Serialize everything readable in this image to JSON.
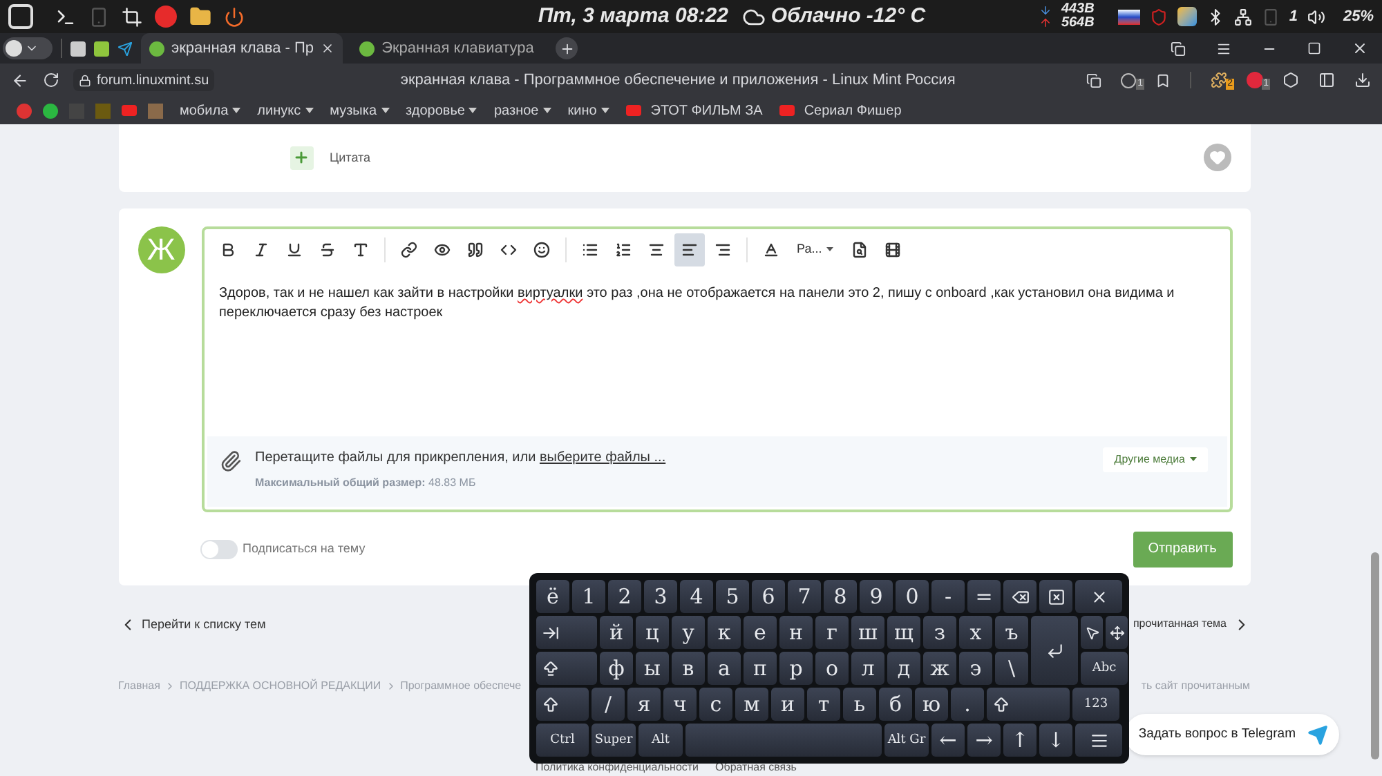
{
  "system_panel": {
    "clock": "Пт, 3 марта 08:22",
    "weather": "Облачно -12° C",
    "net_down": "443B",
    "net_up": "564B",
    "workspace": "1",
    "battery": "25%"
  },
  "browser": {
    "tabs": [
      {
        "title": "экранная клава - Пр",
        "selected": true
      },
      {
        "title": "Экранная клавиатура",
        "selected": false
      }
    ],
    "url": "forum.linuxmint.su",
    "page_title": "экранная клава - Программное обеспечение и приложения - Linux Mint Россия",
    "extension_badges": [
      "1",
      "2",
      "1"
    ],
    "bookmarks": [
      {
        "label": "мобила",
        "kind": "folder"
      },
      {
        "label": "линукс",
        "kind": "folder"
      },
      {
        "label": "музыка",
        "kind": "folder"
      },
      {
        "label": "здоровье",
        "kind": "folder"
      },
      {
        "label": "разное",
        "kind": "folder"
      },
      {
        "label": "кино",
        "kind": "folder"
      },
      {
        "label": "ЭТОТ ФИЛЬМ ЗА",
        "kind": "video"
      },
      {
        "label": "Сериал Фишер",
        "kind": "video"
      }
    ]
  },
  "post_actions": {
    "quote": "Цитата",
    "liked": false
  },
  "editor": {
    "avatar_letter": "Ж",
    "toolbar": [
      {
        "kind": "bold",
        "selected": false
      },
      {
        "kind": "italic",
        "selected": false
      },
      {
        "kind": "underline",
        "selected": false
      },
      {
        "kind": "strike",
        "selected": false
      },
      {
        "kind": "style",
        "selected": false
      },
      {
        "kind": "divider"
      },
      {
        "kind": "link",
        "selected": false
      },
      {
        "kind": "preview",
        "selected": false
      },
      {
        "kind": "quote",
        "selected": false
      },
      {
        "kind": "code",
        "selected": false
      },
      {
        "kind": "emoji",
        "selected": false
      },
      {
        "kind": "divider"
      },
      {
        "kind": "bullets",
        "selected": false
      },
      {
        "kind": "numbers",
        "selected": false
      },
      {
        "kind": "center",
        "selected": false
      },
      {
        "kind": "align_left",
        "selected": true
      },
      {
        "kind": "align_right",
        "selected": false
      },
      {
        "kind": "divider"
      },
      {
        "kind": "color",
        "selected": false
      },
      {
        "kind": "size",
        "label": "Ра...",
        "selected": false
      },
      {
        "kind": "find",
        "selected": false
      },
      {
        "kind": "gif",
        "selected": false
      }
    ],
    "text": [
      {
        "text": "Здоров, так и не нашел как зайти в настройки ",
        "misspelled": false
      },
      {
        "text": "виртуалки",
        "misspelled": true
      },
      {
        "text": " это раз ,она не отображается на панели это 2, пишу с onboard ,как установил она видима и переключается сразу без настроек",
        "misspelled": false
      }
    ],
    "attach_prompt": "Перетащите файлы для прикрепления, или ",
    "attach_link": "выберите файлы ...",
    "limit_label": "Максимальный общий размер:",
    "limit_value": "48.83 МБ",
    "media_button": "Другие медиа"
  },
  "subscribe": {
    "label": "Подписаться на тему",
    "on": false
  },
  "submit": "Отправить",
  "nav": {
    "back": "Перейти к списку тем",
    "next": "прочитанная тема"
  },
  "breadcrumb": [
    "Главная",
    "ПОДДЕРЖКА ОСНОВНОЙ РЕДАКЦИИ",
    "Программное обеспече"
  ],
  "breadcrumb_right": "ть сайт прочитанным",
  "footer_links": [
    "Политика конфиденциальности",
    "Обратная связь"
  ],
  "telegram_button": "Задать вопрос в Telegram",
  "keyboard": {
    "rows": [
      {
        "keys": [
          {
            "kind": "char",
            "label": "ё"
          },
          {
            "kind": "char",
            "label": "1"
          },
          {
            "kind": "char",
            "label": "2"
          },
          {
            "kind": "char",
            "label": "3"
          },
          {
            "kind": "char",
            "label": "4"
          },
          {
            "kind": "char",
            "label": "5"
          },
          {
            "kind": "char",
            "label": "6"
          },
          {
            "kind": "char",
            "label": "7"
          },
          {
            "kind": "char",
            "label": "8"
          },
          {
            "kind": "char",
            "label": "9"
          },
          {
            "kind": "char",
            "label": "0"
          },
          {
            "kind": "char",
            "label": "-"
          },
          {
            "kind": "char",
            "label": "="
          },
          {
            "kind": "backspace"
          },
          {
            "kind": "clear"
          },
          {
            "kind": "close"
          }
        ]
      },
      {
        "keys": [
          {
            "kind": "tab"
          },
          {
            "kind": "char",
            "label": "й"
          },
          {
            "kind": "char",
            "label": "ц"
          },
          {
            "kind": "char",
            "label": "у"
          },
          {
            "kind": "char",
            "label": "к"
          },
          {
            "kind": "char",
            "label": "е"
          },
          {
            "kind": "char",
            "label": "н"
          },
          {
            "kind": "char",
            "label": "г"
          },
          {
            "kind": "char",
            "label": "ш"
          },
          {
            "kind": "char",
            "label": "щ"
          },
          {
            "kind": "char",
            "label": "з"
          },
          {
            "kind": "char",
            "label": "х"
          },
          {
            "kind": "char",
            "label": "ъ"
          },
          {
            "kind": "enter"
          },
          {
            "kind": "pointer"
          },
          {
            "kind": "move"
          }
        ]
      },
      {
        "keys": [
          {
            "kind": "caps"
          },
          {
            "kind": "char",
            "label": "ф"
          },
          {
            "kind": "char",
            "label": "ы"
          },
          {
            "kind": "char",
            "label": "в"
          },
          {
            "kind": "char",
            "label": "а"
          },
          {
            "kind": "char",
            "label": "п"
          },
          {
            "kind": "char",
            "label": "р"
          },
          {
            "kind": "char",
            "label": "о"
          },
          {
            "kind": "char",
            "label": "л"
          },
          {
            "kind": "char",
            "label": "д"
          },
          {
            "kind": "char",
            "label": "ж"
          },
          {
            "kind": "char",
            "label": "э"
          },
          {
            "kind": "char",
            "label": "\\"
          },
          {
            "kind": "side",
            "label": "Abc"
          }
        ]
      },
      {
        "keys": [
          {
            "kind": "shift"
          },
          {
            "kind": "char",
            "label": "/"
          },
          {
            "kind": "char",
            "label": "я"
          },
          {
            "kind": "char",
            "label": "ч"
          },
          {
            "kind": "char",
            "label": "с"
          },
          {
            "kind": "char",
            "label": "м"
          },
          {
            "kind": "char",
            "label": "и"
          },
          {
            "kind": "char",
            "label": "т"
          },
          {
            "kind": "char",
            "label": "ь"
          },
          {
            "kind": "char",
            "label": "б"
          },
          {
            "kind": "char",
            "label": "ю"
          },
          {
            "kind": "char",
            "label": "."
          },
          {
            "kind": "shift_right"
          },
          {
            "kind": "side",
            "label": "123"
          }
        ]
      },
      {
        "keys": [
          {
            "kind": "ctrl",
            "label": "Ctrl"
          },
          {
            "kind": "mod",
            "label": "Super"
          },
          {
            "kind": "mod",
            "label": "Alt"
          },
          {
            "kind": "space"
          },
          {
            "kind": "mod",
            "label": "Alt Gr"
          },
          {
            "kind": "char",
            "label": "←"
          },
          {
            "kind": "char",
            "label": "→"
          },
          {
            "kind": "char",
            "label": "↑"
          },
          {
            "kind": "char",
            "label": "↓"
          },
          {
            "kind": "menu"
          }
        ]
      }
    ]
  }
}
